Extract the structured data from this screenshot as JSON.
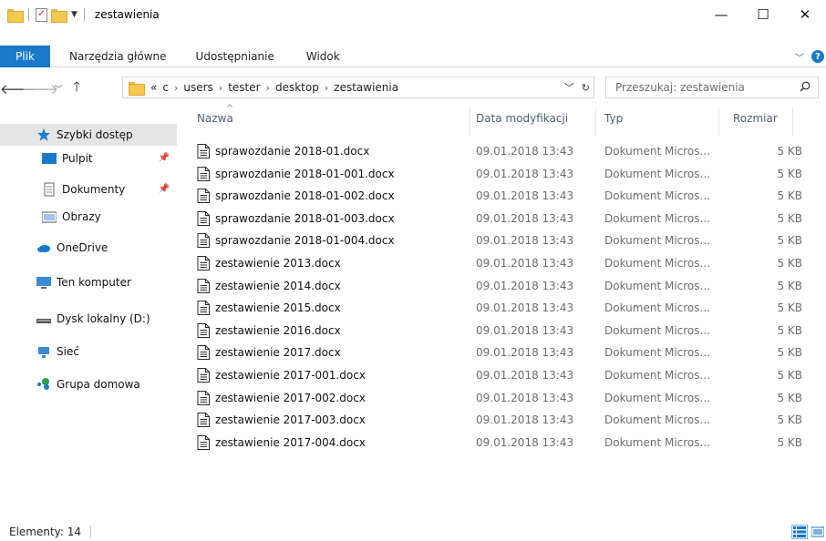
{
  "window": {
    "title": "zestawienia",
    "minimize_glyph": "—",
    "maximize_glyph": "☐",
    "close_glyph": "✕"
  },
  "ribbon": {
    "tabs": [
      "Plik",
      "Narzędzia główne",
      "Udostępnianie",
      "Widok"
    ],
    "accent_color": "#1979ca"
  },
  "address": {
    "overflow": "«",
    "crumbs": [
      "c",
      "users",
      "tester",
      "desktop",
      "zestawienia"
    ],
    "separator": "›"
  },
  "search": {
    "placeholder": "Przeszukaj: zestawienia"
  },
  "sidebar": {
    "items": [
      {
        "label": "Szybki dostęp",
        "icon": "star-icon"
      },
      {
        "label": "Pulpit",
        "icon": "desktop-icon"
      },
      {
        "label": "Dokumenty",
        "icon": "documents-icon"
      },
      {
        "label": "Obrazy",
        "icon": "pictures-icon"
      },
      {
        "label": "OneDrive",
        "icon": "cloud-icon"
      },
      {
        "label": "Ten komputer",
        "icon": "computer-icon"
      },
      {
        "label": "Dysk lokalny (D:)",
        "icon": "drive-icon"
      },
      {
        "label": "Sieć",
        "icon": "network-icon"
      },
      {
        "label": "Grupa domowa",
        "icon": "homegroup-icon"
      }
    ]
  },
  "columns": {
    "name": "Nazwa",
    "date": "Data modyfikacji",
    "type": "Typ",
    "size": "Rozmiar"
  },
  "files": [
    {
      "name": "sprawozdanie 2018-01.docx",
      "date": "09.01.2018 13:43",
      "type": "Dokument Micros...",
      "size": "5 KB"
    },
    {
      "name": "sprawozdanie 2018-01-001.docx",
      "date": "09.01.2018 13:43",
      "type": "Dokument Micros...",
      "size": "5 KB"
    },
    {
      "name": "sprawozdanie 2018-01-002.docx",
      "date": "09.01.2018 13:43",
      "type": "Dokument Micros...",
      "size": "5 KB"
    },
    {
      "name": "sprawozdanie 2018-01-003.docx",
      "date": "09.01.2018 13:43",
      "type": "Dokument Micros...",
      "size": "5 KB"
    },
    {
      "name": "sprawozdanie 2018-01-004.docx",
      "date": "09.01.2018 13:43",
      "type": "Dokument Micros...",
      "size": "5 KB"
    },
    {
      "name": "zestawienie 2013.docx",
      "date": "09.01.2018 13:43",
      "type": "Dokument Micros...",
      "size": "5 KB"
    },
    {
      "name": "zestawienie 2014.docx",
      "date": "09.01.2018 13:43",
      "type": "Dokument Micros...",
      "size": "5 KB"
    },
    {
      "name": "zestawienie 2015.docx",
      "date": "09.01.2018 13:43",
      "type": "Dokument Micros...",
      "size": "5 KB"
    },
    {
      "name": "zestawienie 2016.docx",
      "date": "09.01.2018 13:43",
      "type": "Dokument Micros...",
      "size": "5 KB"
    },
    {
      "name": "zestawienie 2017.docx",
      "date": "09.01.2018 13:43",
      "type": "Dokument Micros...",
      "size": "5 KB"
    },
    {
      "name": "zestawienie 2017-001.docx",
      "date": "09.01.2018 13:43",
      "type": "Dokument Micros...",
      "size": "5 KB"
    },
    {
      "name": "zestawienie 2017-002.docx",
      "date": "09.01.2018 13:43",
      "type": "Dokument Micros...",
      "size": "5 KB"
    },
    {
      "name": "zestawienie 2017-003.docx",
      "date": "09.01.2018 13:43",
      "type": "Dokument Micros...",
      "size": "5 KB"
    },
    {
      "name": "zestawienie 2017-004.docx",
      "date": "09.01.2018 13:43",
      "type": "Dokument Micros...",
      "size": "5 KB"
    }
  ],
  "status": {
    "items_text": "Elementy: 14"
  }
}
